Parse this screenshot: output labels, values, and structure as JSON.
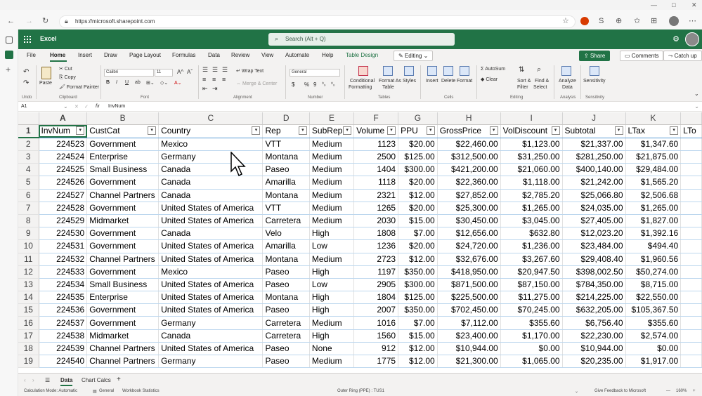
{
  "browser": {
    "url": "https://microsoft.sharepoint.com",
    "controls": {
      "minimize": "—",
      "maximize": "□",
      "close": "✕"
    }
  },
  "app": {
    "name": "Excel",
    "search_placeholder": "Search (Alt + Q)",
    "brand_color": "#217346"
  },
  "ribbon_tabs": [
    "File",
    "Home",
    "Insert",
    "Draw",
    "Page Layout",
    "Formulas",
    "Data",
    "Review",
    "View",
    "Automate",
    "Help",
    "Table Design"
  ],
  "active_tab": "Home",
  "ribbon_buttons": {
    "editing": "Editing",
    "share": "Share",
    "comments": "Comments",
    "catch_up": "Catch up"
  },
  "ribbon": {
    "undo_group": "Undo",
    "clipboard": {
      "paste": "Paste",
      "cut": "Cut",
      "copy": "Copy",
      "format_painter": "Format Painter",
      "label": "Clipboard"
    },
    "font": {
      "name": "Calibri",
      "size": "11",
      "label": "Font",
      "bold": "B",
      "italic": "I",
      "underline": "U"
    },
    "alignment": {
      "wrap": "Wrap Text",
      "merge": "Merge & Center",
      "label": "Alignment"
    },
    "number": {
      "format": "General",
      "currency": "$",
      "percent": "%",
      "comma": "9",
      "label": "Number"
    },
    "tables": {
      "conditional": "Conditional",
      "formatting": "Formatting",
      "format_as": "Format As",
      "table": "Table",
      "styles": "Styles",
      "label": "Tables"
    },
    "cells": {
      "insert": "Insert",
      "delete": "Delete",
      "format": "Format",
      "label": "Cells"
    },
    "editing": {
      "autosum": "AutoSum",
      "clear": "Clear",
      "sort": "Sort &",
      "filter": "Filter",
      "find": "Find &",
      "select": "Select",
      "label": "Editing"
    },
    "analysis": {
      "analyze": "Analyze",
      "data": "Data",
      "label": "Analysis"
    },
    "sensitivity": {
      "label_btn": "Sensitivity",
      "label": "Sensitivity"
    }
  },
  "formula_bar": {
    "name_box": "A1",
    "fx": "fx",
    "content": "InvNum"
  },
  "columns": [
    "A",
    "B",
    "C",
    "D",
    "E",
    "F",
    "G",
    "H",
    "I",
    "J",
    "K"
  ],
  "headers": [
    "InvNum",
    "CustCat",
    "Country",
    "Rep",
    "SubRep",
    "Volume",
    "PPU",
    "GrossPrice",
    "VolDiscount",
    "Subtotal",
    "LTax",
    "LTo"
  ],
  "rows": [
    {
      "n": "2",
      "c": [
        "224523",
        "Government",
        "Mexico",
        "VTT",
        "Medium",
        "1123",
        "$20.00",
        "$22,460.00",
        "$1,123.00",
        "$21,337.00",
        "$1,347.60"
      ]
    },
    {
      "n": "3",
      "c": [
        "224524",
        "Enterprise",
        "Germany",
        "Montana",
        "Medium",
        "2500",
        "$125.00",
        "$312,500.00",
        "$31,250.00",
        "$281,250.00",
        "$21,875.00"
      ]
    },
    {
      "n": "4",
      "c": [
        "224525",
        "Small Business",
        "Canada",
        "Paseo",
        "Medium",
        "1404",
        "$300.00",
        "$421,200.00",
        "$21,060.00",
        "$400,140.00",
        "$29,484.00"
      ]
    },
    {
      "n": "5",
      "c": [
        "224526",
        "Government",
        "Canada",
        "Amarilla",
        "Medium",
        "1118",
        "$20.00",
        "$22,360.00",
        "$1,118.00",
        "$21,242.00",
        "$1,565.20"
      ]
    },
    {
      "n": "6",
      "c": [
        "224527",
        "Channel Partners",
        "Canada",
        "Montana",
        "Medium",
        "2321",
        "$12.00",
        "$27,852.00",
        "$2,785.20",
        "$25,066.80",
        "$2,506.68"
      ]
    },
    {
      "n": "7",
      "c": [
        "224528",
        "Government",
        "United States of America",
        "VTT",
        "Medium",
        "1265",
        "$20.00",
        "$25,300.00",
        "$1,265.00",
        "$24,035.00",
        "$1,265.00"
      ]
    },
    {
      "n": "8",
      "c": [
        "224529",
        "Midmarket",
        "United States of America",
        "Carretera",
        "Medium",
        "2030",
        "$15.00",
        "$30,450.00",
        "$3,045.00",
        "$27,405.00",
        "$1,827.00"
      ]
    },
    {
      "n": "9",
      "c": [
        "224530",
        "Government",
        "Canada",
        "Velo",
        "High",
        "1808",
        "$7.00",
        "$12,656.00",
        "$632.80",
        "$12,023.20",
        "$1,392.16"
      ]
    },
    {
      "n": "10",
      "c": [
        "224531",
        "Government",
        "United States of America",
        "Amarilla",
        "Low",
        "1236",
        "$20.00",
        "$24,720.00",
        "$1,236.00",
        "$23,484.00",
        "$494.40"
      ]
    },
    {
      "n": "11",
      "c": [
        "224532",
        "Channel Partners",
        "United States of America",
        "Montana",
        "Medium",
        "2723",
        "$12.00",
        "$32,676.00",
        "$3,267.60",
        "$29,408.40",
        "$1,960.56"
      ]
    },
    {
      "n": "12",
      "c": [
        "224533",
        "Government",
        "Mexico",
        "Paseo",
        "High",
        "1197",
        "$350.00",
        "$418,950.00",
        "$20,947.50",
        "$398,002.50",
        "$50,274.00"
      ]
    },
    {
      "n": "13",
      "c": [
        "224534",
        "Small Business",
        "United States of America",
        "Paseo",
        "Low",
        "2905",
        "$300.00",
        "$871,500.00",
        "$87,150.00",
        "$784,350.00",
        "$8,715.00"
      ]
    },
    {
      "n": "14",
      "c": [
        "224535",
        "Enterprise",
        "United States of America",
        "Montana",
        "High",
        "1804",
        "$125.00",
        "$225,500.00",
        "$11,275.00",
        "$214,225.00",
        "$22,550.00"
      ]
    },
    {
      "n": "15",
      "c": [
        "224536",
        "Government",
        "United States of America",
        "Paseo",
        "High",
        "2007",
        "$350.00",
        "$702,450.00",
        "$70,245.00",
        "$632,205.00",
        "$105,367.50"
      ]
    },
    {
      "n": "16",
      "c": [
        "224537",
        "Government",
        "Germany",
        "Carretera",
        "Medium",
        "1016",
        "$7.00",
        "$7,112.00",
        "$355.60",
        "$6,756.40",
        "$355.60"
      ]
    },
    {
      "n": "17",
      "c": [
        "224538",
        "Midmarket",
        "Canada",
        "Carretera",
        "High",
        "1560",
        "$15.00",
        "$23,400.00",
        "$1,170.00",
        "$22,230.00",
        "$2,574.00"
      ]
    },
    {
      "n": "18",
      "c": [
        "224539",
        "Channel Partners",
        "United States of America",
        "Paseo",
        "None",
        "912",
        "$12.00",
        "$10,944.00",
        "$0.00",
        "$10,944.00",
        "$0.00"
      ]
    },
    {
      "n": "19",
      "c": [
        "224540",
        "Channel Partners",
        "Germany",
        "Paseo",
        "Medium",
        "1775",
        "$12.00",
        "$21,300.00",
        "$1,065.00",
        "$20,235.00",
        "$1,917.00"
      ]
    }
  ],
  "sheet_tabs": [
    "Data",
    "Chart Calcs"
  ],
  "add_sheet": "+",
  "status": {
    "calc_mode": "Calculation Mode: Automatic",
    "general": "General",
    "stats": "Workbook Statistics",
    "ring": "Outer Ring (PPE) : TUS1",
    "feedback": "Give Feedback to Microsoft",
    "zoom": "160%",
    "zoom_minus": "—",
    "zoom_plus": "+"
  }
}
